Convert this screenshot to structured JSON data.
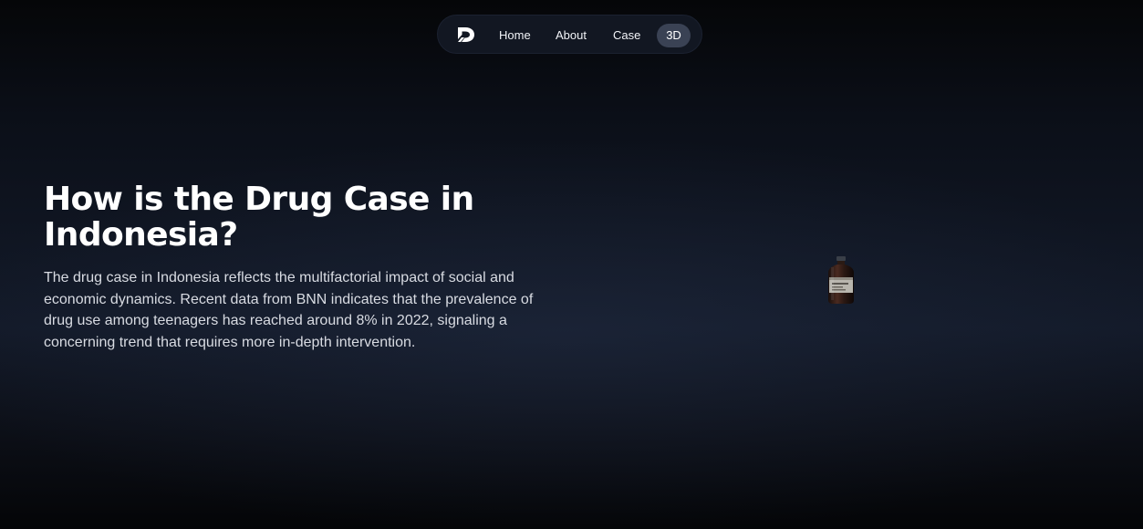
{
  "nav": {
    "logo_icon": "logo-icon",
    "items": [
      {
        "label": "Home"
      },
      {
        "label": "About"
      },
      {
        "label": "Case"
      },
      {
        "label": "3D",
        "active": true
      }
    ]
  },
  "hero": {
    "title": "How is the Drug Case in Indonesia?",
    "description": "The drug case in Indonesia reflects the multifactorial impact of social and economic dynamics. Recent data from BNN indicates that the prevalence of drug use among teenagers has reached around 8% in 2022, signaling a concerning trend that requires more in-depth intervention."
  },
  "model": {
    "icon": "medicine-bottle-icon"
  },
  "colors": {
    "background_top": "#050608",
    "background_mid": "#131a29",
    "nav_background": "#121722",
    "active_pill": "#3a4254",
    "text_primary": "#ffffff",
    "text_secondary": "#d8dbe2"
  }
}
